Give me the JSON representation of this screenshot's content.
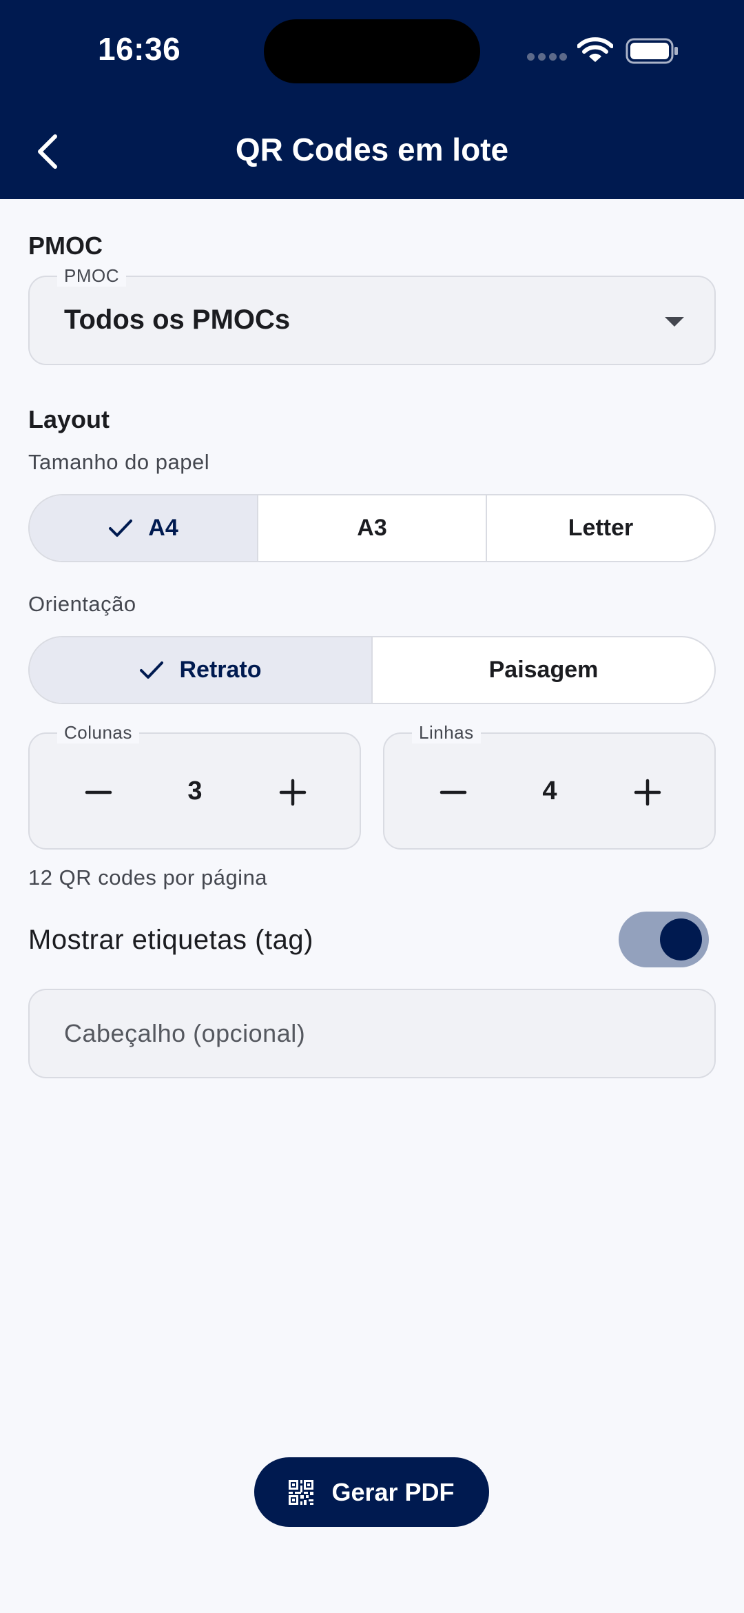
{
  "status_bar": {
    "time": "16:36"
  },
  "header": {
    "title": "QR Codes em lote"
  },
  "pmoc_section": {
    "title": "PMOC",
    "field_label": "PMOC",
    "selected": "Todos os PMOCs"
  },
  "layout_section": {
    "title": "Layout",
    "paper_size_label": "Tamanho do papel",
    "paper_sizes": [
      {
        "label": "A4",
        "selected": true
      },
      {
        "label": "A3",
        "selected": false
      },
      {
        "label": "Letter",
        "selected": false
      }
    ],
    "orientation_label": "Orientação",
    "orientations": [
      {
        "label": "Retrato",
        "selected": true
      },
      {
        "label": "Paisagem",
        "selected": false
      }
    ],
    "columns": {
      "label": "Colunas",
      "value": "3"
    },
    "rows": {
      "label": "Linhas",
      "value": "4"
    },
    "per_page_text": "12 QR codes por página"
  },
  "show_tags": {
    "label": "Mostrar etiquetas (tag)",
    "enabled": true
  },
  "header_input": {
    "placeholder": "Cabeçalho (opcional)",
    "value": ""
  },
  "generate_button": {
    "label": "Gerar PDF"
  },
  "colors": {
    "primary": "#001a50",
    "background": "#f7f8fc",
    "selected_segment": "#e7e9f2",
    "toggle_track": "#93a1bd"
  }
}
